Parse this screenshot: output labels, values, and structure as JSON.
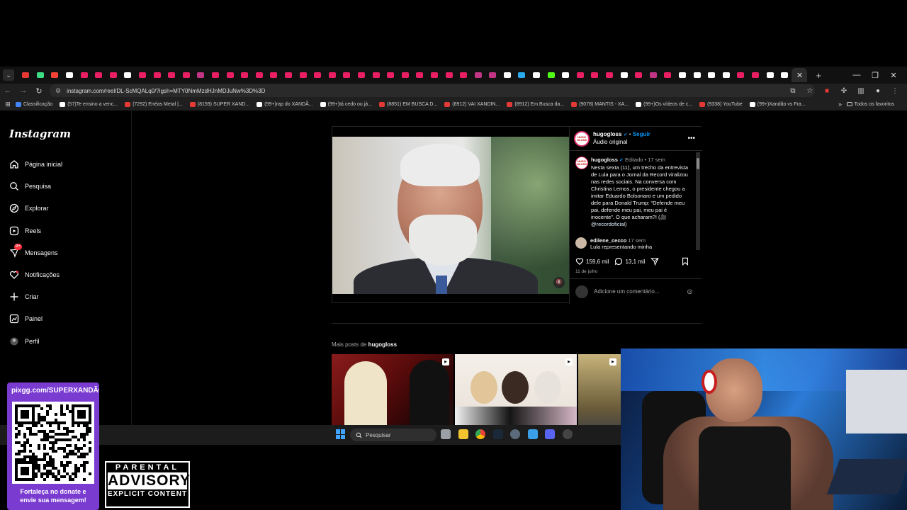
{
  "browser": {
    "url": "instagram.com/reel/DL-ScMQALq0/?igsh=MTY0NmMzdHJnMDJuNw%3D%3D",
    "tab_colors": [
      "#e53935",
      "#3ddc84",
      "#f44336",
      "#ffffff",
      "#e91e63",
      "#e91e63",
      "#e91e63",
      "#ffffff",
      "#e91e63",
      "#e91e63",
      "#e91e63",
      "#e91e63",
      "#c13584",
      "#e91e63",
      "#e91e63",
      "#e91e63",
      "#e91e63",
      "#e91e63",
      "#e91e63",
      "#e91e63",
      "#e91e63",
      "#e91e63",
      "#e91e63",
      "#e91e63",
      "#e91e63",
      "#e91e63",
      "#e91e63",
      "#e91e63",
      "#e91e63",
      "#e91e63",
      "#e91e63",
      "#c13584",
      "#c13584",
      "#ffffff",
      "#2aabee",
      "#ffffff",
      "#53fc18",
      "#ffffff",
      "#e91e63",
      "#e91e63",
      "#e91e63",
      "#ffffff",
      "#e91e63",
      "#c13584",
      "#e91e63",
      "#ffffff",
      "#ffffff",
      "#ffffff",
      "#ffffff",
      "#e91e63",
      "#e91e63",
      "#ffffff",
      "#ffffff"
    ],
    "bookmarks": [
      {
        "label": "Classificação",
        "color": "#4285f4"
      },
      {
        "label": "(57)Te ensino a venc...",
        "color": "#ffffff"
      },
      {
        "label": "(7292) Enéas Metal |...",
        "color": "#e53935"
      },
      {
        "label": "(8159) SUPER XAND...",
        "color": "#e53935"
      },
      {
        "label": "(99+)rap do XANDÃ...",
        "color": "#ffffff"
      },
      {
        "label": "(99+)tá cedo ou já...",
        "color": "#ffffff"
      },
      {
        "label": "(8851) EM BUSCA D...",
        "color": "#e53935"
      },
      {
        "label": "(8912) VAI XANDIN...",
        "color": "#e53935"
      },
      {
        "label": "(8912) Em Busca da...",
        "color": "#e53935"
      },
      {
        "label": "(9078) MANTIS - XA...",
        "color": "#e53935"
      },
      {
        "label": "(99+)Os vídeos de c...",
        "color": "#ffffff"
      },
      {
        "label": "(9338) YouTube",
        "color": "#e53935"
      },
      {
        "label": "(99+)Xandão vs Fra...",
        "color": "#ffffff"
      }
    ],
    "favorites_label": "Todos os favoritos"
  },
  "sidebar": {
    "logo": "Instagram",
    "badge": "9+",
    "items": [
      {
        "label": "Página inicial",
        "icon": "home-icon"
      },
      {
        "label": "Pesquisa",
        "icon": "search-icon"
      },
      {
        "label": "Explorar",
        "icon": "compass-icon"
      },
      {
        "label": "Reels",
        "icon": "reels-icon"
      },
      {
        "label": "Mensagens",
        "icon": "messenger-icon"
      },
      {
        "label": "Notificações",
        "icon": "heart-icon"
      },
      {
        "label": "Criar",
        "icon": "plus-icon"
      },
      {
        "label": "Painel",
        "icon": "chart-icon"
      },
      {
        "label": "Perfil",
        "icon": "profile-icon"
      }
    ]
  },
  "post": {
    "avatar_text": "HUGO GLOSS",
    "username": "hugogloss",
    "separator": "•",
    "follow_label": "Seguir",
    "audio": "Áudio original",
    "caption_edited": "Editado",
    "caption_time": "17 sem",
    "caption_text": "Nesta sexta (11), um trecho da entrevista de Lula para o Jornal da Record viralizou nas redes sociais. Na conversa com Christina Lemos, o presidente chegou a imitar Eduardo Bolsonaro e um pedido dele para Donald Trump: “Defende meu pai, defende meu pai, meu pai é inocente”. O que acharam?! (🎥",
    "caption_mention": "@recordoficial",
    "caption_end": ")",
    "comment_user": "edilene_cecco",
    "comment_time": "17 sem",
    "comment_text": "Lula representando minha",
    "likes": "159,6 mil",
    "comments": "13,1 mil",
    "date": "11 de julho",
    "add_comment_placeholder": "Adicione um comentário..."
  },
  "more_posts": {
    "prefix": "Mais posts de",
    "user": "hugogloss"
  },
  "taskbar": {
    "search_label": "Pesquisar"
  },
  "overlay": {
    "donate_url": "pixgg.com/SUPERXANDÃO",
    "donate_msg_1": "Fortaleça no donate e",
    "donate_msg_2": "envie sua mensagem!",
    "advisory_l1": "PARENTAL",
    "advisory_l2": "ADVISORY",
    "advisory_l3": "EXPLICIT CONTENT"
  }
}
